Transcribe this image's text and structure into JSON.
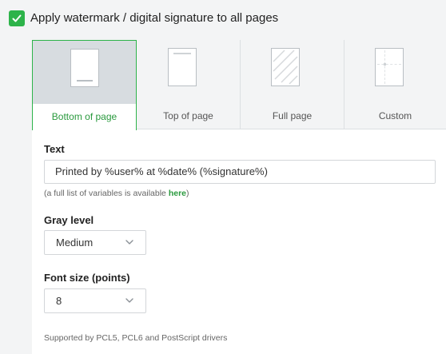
{
  "header": {
    "checked": true,
    "label": "Apply watermark / digital signature to all pages",
    "accent": "#2db34a"
  },
  "tabs": [
    {
      "label": "Bottom of page",
      "icon": "page-bottom-line-icon",
      "selected": true
    },
    {
      "label": "Top of page",
      "icon": "page-top-line-icon",
      "selected": false
    },
    {
      "label": "Full page",
      "icon": "page-diagonal-lines-icon",
      "selected": false
    },
    {
      "label": "Custom",
      "icon": "page-custom-icon",
      "selected": false
    }
  ],
  "text_field": {
    "label": "Text",
    "value": "Printed by %user% at %date% (%signature%)"
  },
  "hint": {
    "prefix": "(a full list of variables is available ",
    "link": "here",
    "suffix": ")"
  },
  "gray_level": {
    "label": "Gray level",
    "value": "Medium",
    "icon": "chevron-down-icon"
  },
  "font_size": {
    "label": "Font size (points)",
    "value": "8",
    "icon": "chevron-down-icon"
  },
  "footnote": "Supported by PCL5, PCL6 and PostScript drivers"
}
